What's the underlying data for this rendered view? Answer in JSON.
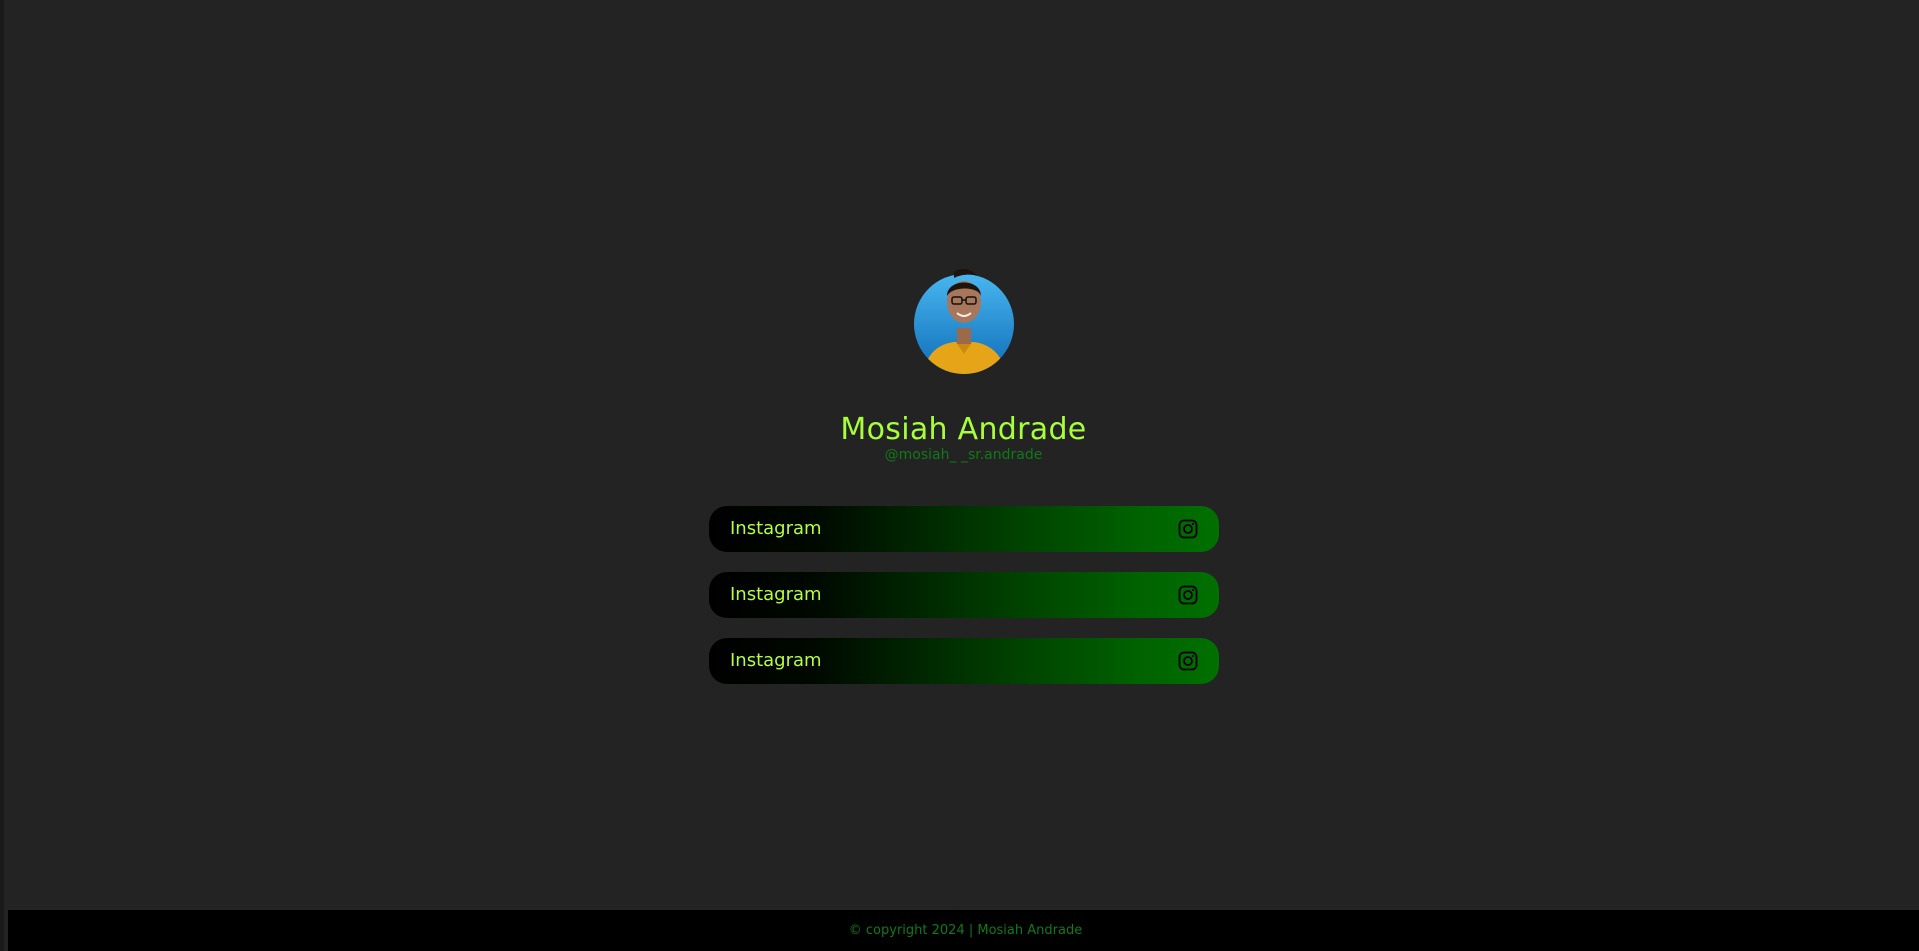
{
  "profile": {
    "name": "Mosiah Andrade",
    "handle": "@mosiah_ _sr.andrade",
    "avatar_icon": "profile-photo"
  },
  "links": [
    {
      "label": "Instagram",
      "icon": "instagram-icon"
    },
    {
      "label": "Instagram",
      "icon": "instagram-icon"
    },
    {
      "label": "Instagram",
      "icon": "instagram-icon"
    }
  ],
  "footer": {
    "text": "© copyright 2024 | Mosiah Andrade"
  },
  "colors": {
    "background": "#232323",
    "name": "#a7ff3a",
    "handle": "#0f7a17",
    "link_text": "#b6ff3f",
    "footer_bg": "#000000"
  }
}
